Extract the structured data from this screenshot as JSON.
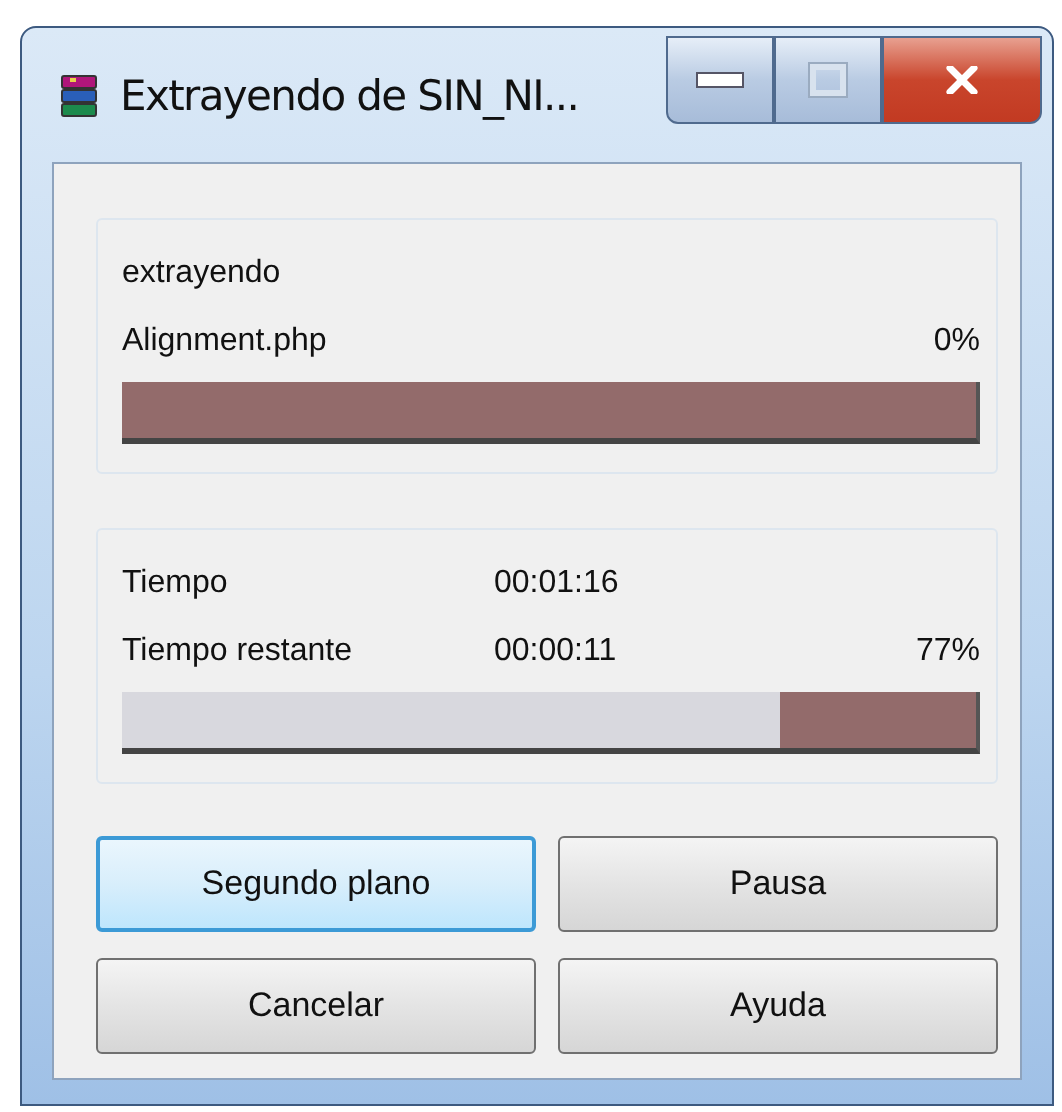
{
  "window": {
    "title": "Extrayendo de SIN_NI..."
  },
  "file_panel": {
    "action": "extrayendo",
    "file": "Alignment.php",
    "percent": "0%",
    "level": 0
  },
  "total_panel": {
    "rows": [
      {
        "label": "Tiempo",
        "value": "00:01:16"
      },
      {
        "label": "Tiempo restante",
        "value": "00:00:11"
      }
    ],
    "percent": "77%",
    "level": 0.77
  },
  "buttons": [
    {
      "label": "Segundo plano",
      "focused": true
    },
    {
      "label": "Pausa",
      "focused": false
    },
    {
      "label": "Cancelar",
      "focused": false
    },
    {
      "label": "Ayuda",
      "focused": false
    }
  ]
}
